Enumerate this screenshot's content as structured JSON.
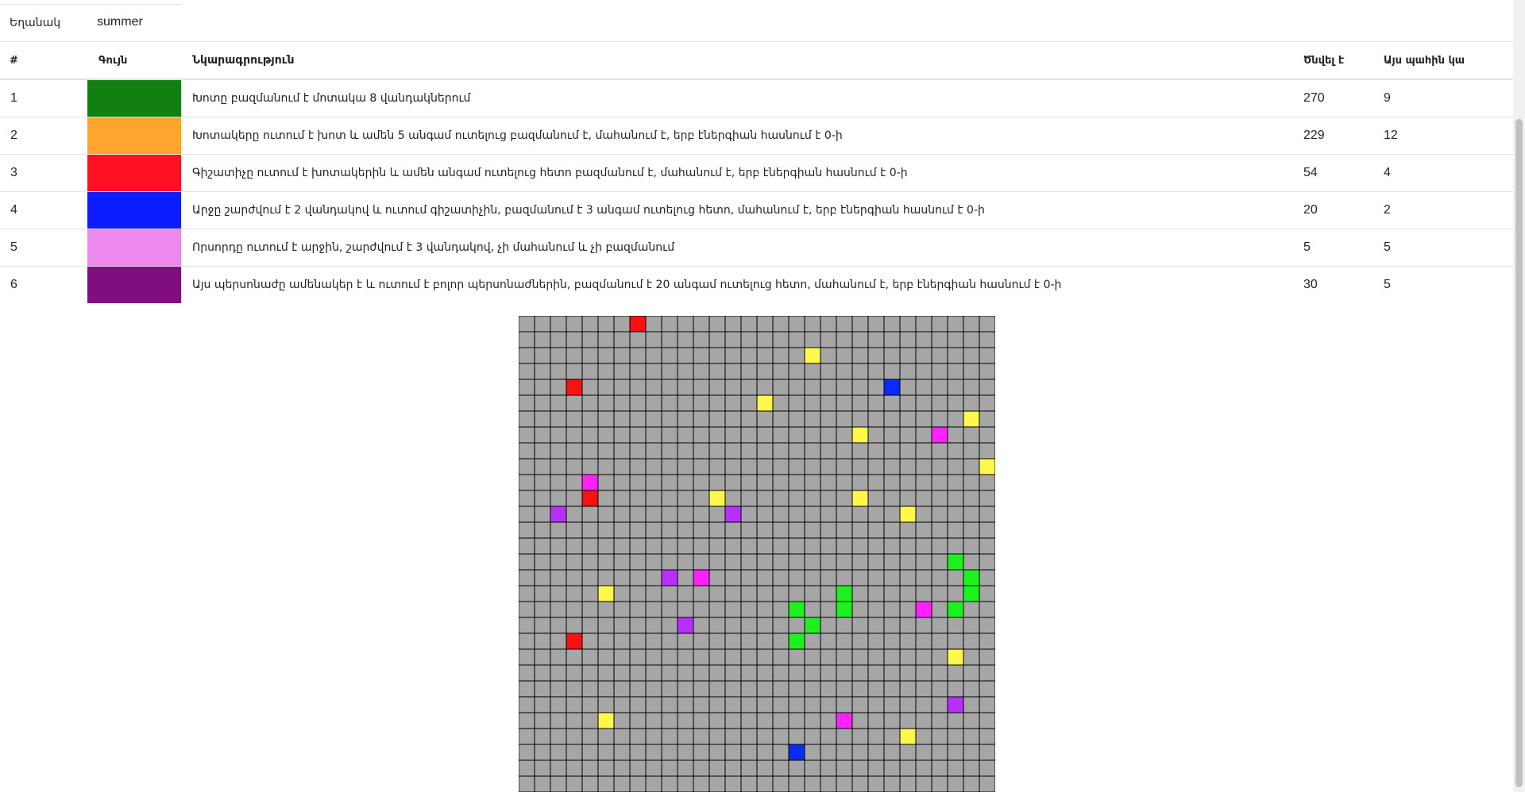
{
  "weather": {
    "label": "Եղանակ",
    "value": "summer"
  },
  "table": {
    "headers": {
      "num": "#",
      "color": "Գույն",
      "description": "Նկարագրություն",
      "born": "Ծնվել է",
      "current": "Այս պահին կա"
    },
    "rows": [
      {
        "num": "1",
        "color": "#118011",
        "description": "Խոտը բազմանում է մոտակա 8 վանդակներում",
        "born": "270",
        "current": "9"
      },
      {
        "num": "2",
        "color": "#FFA42C",
        "description": "Խոտակերը ուտում է խոտ և ամեն 5 անգամ ուտելուց բազմանում է, մահանում է, երբ էներգիան հասնում է 0-ի",
        "born": "229",
        "current": "12"
      },
      {
        "num": "3",
        "color": "#FF1020",
        "description": "Գիշատիչը ուտում է խոտակերին և ամեն անգամ ուտելուց հետո բազմանում է, մահանում է, երբ էներգիան հասնում է 0-ի",
        "born": "54",
        "current": "4"
      },
      {
        "num": "4",
        "color": "#0E1DFF",
        "description": "Արջը շարժվում է 2 վանդակով և ուտում գիշատիչին, բազմանում է 3 անգամ ուտելուց հետո, մահանում է, երբ էներգիան հասնում է 0-ի",
        "born": "20",
        "current": "2"
      },
      {
        "num": "5",
        "color": "#EE88EE",
        "description": "Որսորդը ուտում է արջին, շարժվում է 3 վանդակով, չի մահանում և չի բազմանում",
        "born": "5",
        "current": "5"
      },
      {
        "num": "6",
        "color": "#800E80",
        "description": "Այս պերսոնաժը ամենակեր է և ուտում է բոլոր պերսոնաժներին, բազմանում է 20 անգամ ուտելուց հետո, մահանում է, երբ էներգիան հասնում է 0-ի",
        "born": "30",
        "current": "5"
      }
    ]
  },
  "grid": {
    "cols": 30,
    "rows": 30,
    "empty_color": "#A6A6A6",
    "palette": {
      "yellow": "#FFF84A",
      "red": "#FF1010",
      "blue": "#0A2AFF",
      "green": "#1EF21E",
      "magenta": "#FF22FF",
      "purple": "#B830FF"
    },
    "cells": [
      {
        "c": 7,
        "r": 0,
        "t": "red"
      },
      {
        "c": 18,
        "r": 2,
        "t": "yellow"
      },
      {
        "c": 3,
        "r": 4,
        "t": "red"
      },
      {
        "c": 23,
        "r": 4,
        "t": "blue"
      },
      {
        "c": 15,
        "r": 5,
        "t": "yellow"
      },
      {
        "c": 28,
        "r": 6,
        "t": "yellow"
      },
      {
        "c": 21,
        "r": 7,
        "t": "yellow"
      },
      {
        "c": 26,
        "r": 7,
        "t": "magenta"
      },
      {
        "c": 29,
        "r": 9,
        "t": "yellow"
      },
      {
        "c": 4,
        "r": 10,
        "t": "magenta"
      },
      {
        "c": 4,
        "r": 11,
        "t": "red"
      },
      {
        "c": 12,
        "r": 11,
        "t": "yellow"
      },
      {
        "c": 21,
        "r": 11,
        "t": "yellow"
      },
      {
        "c": 2,
        "r": 12,
        "t": "purple"
      },
      {
        "c": 13,
        "r": 12,
        "t": "purple"
      },
      {
        "c": 24,
        "r": 12,
        "t": "yellow"
      },
      {
        "c": 27,
        "r": 15,
        "t": "green"
      },
      {
        "c": 9,
        "r": 16,
        "t": "purple"
      },
      {
        "c": 11,
        "r": 16,
        "t": "magenta"
      },
      {
        "c": 28,
        "r": 16,
        "t": "green"
      },
      {
        "c": 5,
        "r": 17,
        "t": "yellow"
      },
      {
        "c": 20,
        "r": 17,
        "t": "green"
      },
      {
        "c": 28,
        "r": 17,
        "t": "green"
      },
      {
        "c": 17,
        "r": 18,
        "t": "green"
      },
      {
        "c": 20,
        "r": 18,
        "t": "green"
      },
      {
        "c": 25,
        "r": 18,
        "t": "magenta"
      },
      {
        "c": 27,
        "r": 18,
        "t": "green"
      },
      {
        "c": 10,
        "r": 19,
        "t": "purple"
      },
      {
        "c": 18,
        "r": 19,
        "t": "green"
      },
      {
        "c": 3,
        "r": 20,
        "t": "red"
      },
      {
        "c": 17,
        "r": 20,
        "t": "green"
      },
      {
        "c": 27,
        "r": 21,
        "t": "yellow"
      },
      {
        "c": 27,
        "r": 24,
        "t": "purple"
      },
      {
        "c": 5,
        "r": 25,
        "t": "yellow"
      },
      {
        "c": 20,
        "r": 25,
        "t": "magenta"
      },
      {
        "c": 24,
        "r": 26,
        "t": "yellow"
      },
      {
        "c": 17,
        "r": 27,
        "t": "blue"
      }
    ]
  }
}
